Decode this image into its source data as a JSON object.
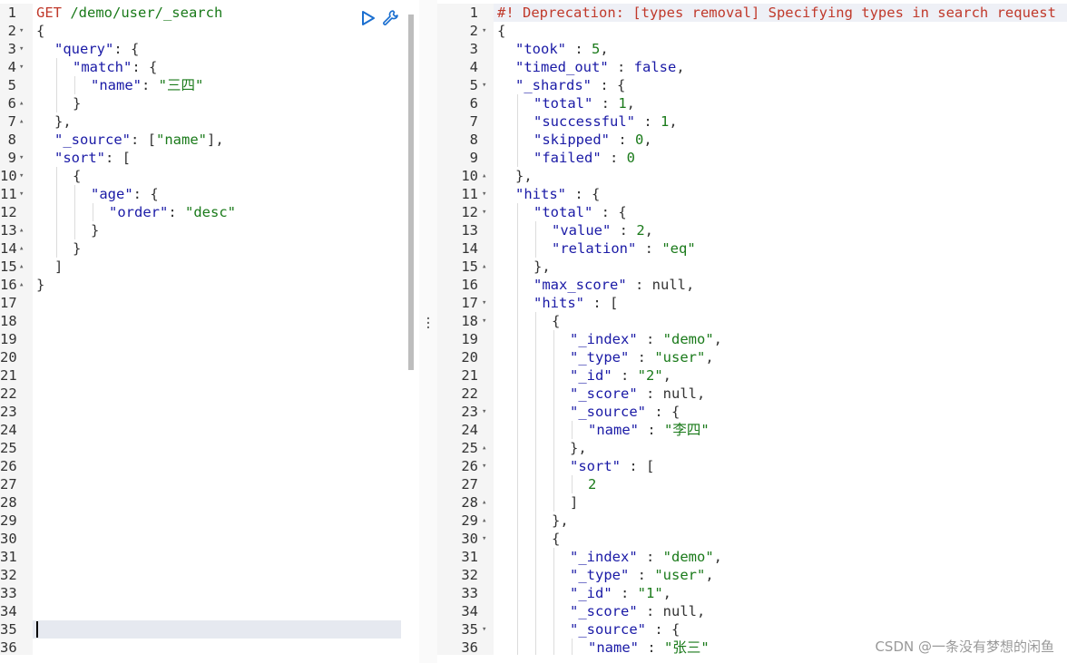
{
  "request": {
    "method": "GET",
    "path": "/demo/user/_search",
    "run_icon": "play-icon",
    "settings_icon": "wrench-icon"
  },
  "left_editor": {
    "line_count": 36,
    "active_line": 35,
    "lines": [
      {
        "n": 1,
        "fold": "",
        "indent": 0,
        "guides": 0,
        "tokens": [
          [
            "m",
            "GET "
          ],
          [
            "u",
            "/demo/user/_search"
          ]
        ]
      },
      {
        "n": 2,
        "fold": "down",
        "indent": 0,
        "guides": 0,
        "tokens": [
          [
            "p",
            "{"
          ]
        ]
      },
      {
        "n": 3,
        "fold": "down",
        "indent": 1,
        "guides": 0,
        "tokens": [
          [
            "k",
            "\"query\""
          ],
          [
            "p",
            ": {"
          ]
        ]
      },
      {
        "n": 4,
        "fold": "down",
        "indent": 1,
        "guides": 1,
        "tokens": [
          [
            "k",
            "\"match\""
          ],
          [
            "p",
            ": {"
          ]
        ]
      },
      {
        "n": 5,
        "fold": "",
        "indent": 1,
        "guides": 2,
        "tokens": [
          [
            "k",
            "\"name\""
          ],
          [
            "p",
            ": "
          ],
          [
            "s",
            "\"三四\""
          ]
        ]
      },
      {
        "n": 6,
        "fold": "up",
        "indent": 1,
        "guides": 1,
        "tokens": [
          [
            "p",
            "}"
          ]
        ]
      },
      {
        "n": 7,
        "fold": "up",
        "indent": 1,
        "guides": 0,
        "tokens": [
          [
            "p",
            "},"
          ]
        ]
      },
      {
        "n": 8,
        "fold": "",
        "indent": 1,
        "guides": 0,
        "tokens": [
          [
            "k",
            "\"_source\""
          ],
          [
            "p",
            ": ["
          ],
          [
            "s",
            "\"name\""
          ],
          [
            "p",
            "],"
          ]
        ]
      },
      {
        "n": 9,
        "fold": "down",
        "indent": 1,
        "guides": 0,
        "tokens": [
          [
            "k",
            "\"sort\""
          ],
          [
            "p",
            ": ["
          ]
        ]
      },
      {
        "n": 10,
        "fold": "down",
        "indent": 1,
        "guides": 1,
        "tokens": [
          [
            "p",
            "{"
          ]
        ]
      },
      {
        "n": 11,
        "fold": "down",
        "indent": 1,
        "guides": 2,
        "tokens": [
          [
            "k",
            "\"age\""
          ],
          [
            "p",
            ": {"
          ]
        ]
      },
      {
        "n": 12,
        "fold": "",
        "indent": 1,
        "guides": 3,
        "tokens": [
          [
            "k",
            "\"order\""
          ],
          [
            "p",
            ": "
          ],
          [
            "s",
            "\"desc\""
          ]
        ]
      },
      {
        "n": 13,
        "fold": "up",
        "indent": 1,
        "guides": 2,
        "tokens": [
          [
            "p",
            "}"
          ]
        ]
      },
      {
        "n": 14,
        "fold": "up",
        "indent": 1,
        "guides": 1,
        "tokens": [
          [
            "p",
            "}"
          ]
        ]
      },
      {
        "n": 15,
        "fold": "up",
        "indent": 1,
        "guides": 0,
        "tokens": [
          [
            "p",
            "]"
          ]
        ]
      },
      {
        "n": 16,
        "fold": "up",
        "indent": 0,
        "guides": 0,
        "tokens": [
          [
            "p",
            "}"
          ]
        ]
      },
      {
        "n": 17,
        "fold": "",
        "indent": 0,
        "guides": 0,
        "tokens": []
      },
      {
        "n": 18,
        "fold": "",
        "indent": 0,
        "guides": 0,
        "tokens": []
      },
      {
        "n": 19,
        "fold": "",
        "indent": 0,
        "guides": 0,
        "tokens": []
      },
      {
        "n": 20,
        "fold": "",
        "indent": 0,
        "guides": 0,
        "tokens": []
      },
      {
        "n": 21,
        "fold": "",
        "indent": 0,
        "guides": 0,
        "tokens": []
      },
      {
        "n": 22,
        "fold": "",
        "indent": 0,
        "guides": 0,
        "tokens": []
      },
      {
        "n": 23,
        "fold": "",
        "indent": 0,
        "guides": 0,
        "tokens": []
      },
      {
        "n": 24,
        "fold": "",
        "indent": 0,
        "guides": 0,
        "tokens": []
      },
      {
        "n": 25,
        "fold": "",
        "indent": 0,
        "guides": 0,
        "tokens": []
      },
      {
        "n": 26,
        "fold": "",
        "indent": 0,
        "guides": 0,
        "tokens": []
      },
      {
        "n": 27,
        "fold": "",
        "indent": 0,
        "guides": 0,
        "tokens": []
      },
      {
        "n": 28,
        "fold": "",
        "indent": 0,
        "guides": 0,
        "tokens": []
      },
      {
        "n": 29,
        "fold": "",
        "indent": 0,
        "guides": 0,
        "tokens": []
      },
      {
        "n": 30,
        "fold": "",
        "indent": 0,
        "guides": 0,
        "tokens": []
      },
      {
        "n": 31,
        "fold": "",
        "indent": 0,
        "guides": 0,
        "tokens": []
      },
      {
        "n": 32,
        "fold": "",
        "indent": 0,
        "guides": 0,
        "tokens": []
      },
      {
        "n": 33,
        "fold": "",
        "indent": 0,
        "guides": 0,
        "tokens": []
      },
      {
        "n": 34,
        "fold": "",
        "indent": 0,
        "guides": 0,
        "tokens": []
      },
      {
        "n": 35,
        "fold": "",
        "indent": 0,
        "guides": 0,
        "tokens": []
      },
      {
        "n": 36,
        "fold": "",
        "indent": 0,
        "guides": 0,
        "tokens": []
      }
    ]
  },
  "right_editor": {
    "lines": [
      {
        "n": 1,
        "fold": "",
        "indent": 0,
        "guides": 0,
        "tokens": [
          [
            "warn",
            "#! Deprecation: [types removal] Specifying types in search request"
          ]
        ]
      },
      {
        "n": 2,
        "fold": "down",
        "indent": 0,
        "guides": 0,
        "tokens": [
          [
            "p",
            "{"
          ]
        ]
      },
      {
        "n": 3,
        "fold": "",
        "indent": 1,
        "guides": 0,
        "tokens": [
          [
            "k",
            "\"took\""
          ],
          [
            "p",
            " : "
          ],
          [
            "n",
            "5"
          ],
          [
            "p",
            ","
          ]
        ]
      },
      {
        "n": 4,
        "fold": "",
        "indent": 1,
        "guides": 0,
        "tokens": [
          [
            "k",
            "\"timed_out\""
          ],
          [
            "p",
            " : "
          ],
          [
            "b",
            "false"
          ],
          [
            "p",
            ","
          ]
        ]
      },
      {
        "n": 5,
        "fold": "down",
        "indent": 1,
        "guides": 0,
        "tokens": [
          [
            "k",
            "\"_shards\""
          ],
          [
            "p",
            " : {"
          ]
        ]
      },
      {
        "n": 6,
        "fold": "",
        "indent": 1,
        "guides": 1,
        "tokens": [
          [
            "k",
            "\"total\""
          ],
          [
            "p",
            " : "
          ],
          [
            "n",
            "1"
          ],
          [
            "p",
            ","
          ]
        ]
      },
      {
        "n": 7,
        "fold": "",
        "indent": 1,
        "guides": 1,
        "tokens": [
          [
            "k",
            "\"successful\""
          ],
          [
            "p",
            " : "
          ],
          [
            "n",
            "1"
          ],
          [
            "p",
            ","
          ]
        ]
      },
      {
        "n": 8,
        "fold": "",
        "indent": 1,
        "guides": 1,
        "tokens": [
          [
            "k",
            "\"skipped\""
          ],
          [
            "p",
            " : "
          ],
          [
            "n",
            "0"
          ],
          [
            "p",
            ","
          ]
        ]
      },
      {
        "n": 9,
        "fold": "",
        "indent": 1,
        "guides": 1,
        "tokens": [
          [
            "k",
            "\"failed\""
          ],
          [
            "p",
            " : "
          ],
          [
            "n",
            "0"
          ]
        ]
      },
      {
        "n": 10,
        "fold": "up",
        "indent": 1,
        "guides": 0,
        "tokens": [
          [
            "p",
            "},"
          ]
        ]
      },
      {
        "n": 11,
        "fold": "down",
        "indent": 1,
        "guides": 0,
        "tokens": [
          [
            "k",
            "\"hits\""
          ],
          [
            "p",
            " : {"
          ]
        ]
      },
      {
        "n": 12,
        "fold": "down",
        "indent": 1,
        "guides": 1,
        "tokens": [
          [
            "k",
            "\"total\""
          ],
          [
            "p",
            " : {"
          ]
        ]
      },
      {
        "n": 13,
        "fold": "",
        "indent": 1,
        "guides": 2,
        "tokens": [
          [
            "k",
            "\"value\""
          ],
          [
            "p",
            " : "
          ],
          [
            "n",
            "2"
          ],
          [
            "p",
            ","
          ]
        ]
      },
      {
        "n": 14,
        "fold": "",
        "indent": 1,
        "guides": 2,
        "tokens": [
          [
            "k",
            "\"relation\""
          ],
          [
            "p",
            " : "
          ],
          [
            "s",
            "\"eq\""
          ]
        ]
      },
      {
        "n": 15,
        "fold": "up",
        "indent": 1,
        "guides": 1,
        "tokens": [
          [
            "p",
            "},"
          ]
        ]
      },
      {
        "n": 16,
        "fold": "",
        "indent": 1,
        "guides": 1,
        "tokens": [
          [
            "k",
            "\"max_score\""
          ],
          [
            "p",
            " : "
          ],
          [
            "nul",
            "null"
          ],
          [
            "p",
            ","
          ]
        ]
      },
      {
        "n": 17,
        "fold": "down",
        "indent": 1,
        "guides": 1,
        "tokens": [
          [
            "k",
            "\"hits\""
          ],
          [
            "p",
            " : ["
          ]
        ]
      },
      {
        "n": 18,
        "fold": "down",
        "indent": 1,
        "guides": 2,
        "tokens": [
          [
            "p",
            "{"
          ]
        ]
      },
      {
        "n": 19,
        "fold": "",
        "indent": 1,
        "guides": 3,
        "tokens": [
          [
            "k",
            "\"_index\""
          ],
          [
            "p",
            " : "
          ],
          [
            "s",
            "\"demo\""
          ],
          [
            "p",
            ","
          ]
        ]
      },
      {
        "n": 20,
        "fold": "",
        "indent": 1,
        "guides": 3,
        "tokens": [
          [
            "k",
            "\"_type\""
          ],
          [
            "p",
            " : "
          ],
          [
            "s",
            "\"user\""
          ],
          [
            "p",
            ","
          ]
        ]
      },
      {
        "n": 21,
        "fold": "",
        "indent": 1,
        "guides": 3,
        "tokens": [
          [
            "k",
            "\"_id\""
          ],
          [
            "p",
            " : "
          ],
          [
            "s",
            "\"2\""
          ],
          [
            "p",
            ","
          ]
        ]
      },
      {
        "n": 22,
        "fold": "",
        "indent": 1,
        "guides": 3,
        "tokens": [
          [
            "k",
            "\"_score\""
          ],
          [
            "p",
            " : "
          ],
          [
            "nul",
            "null"
          ],
          [
            "p",
            ","
          ]
        ]
      },
      {
        "n": 23,
        "fold": "down",
        "indent": 1,
        "guides": 3,
        "tokens": [
          [
            "k",
            "\"_source\""
          ],
          [
            "p",
            " : {"
          ]
        ]
      },
      {
        "n": 24,
        "fold": "",
        "indent": 1,
        "guides": 4,
        "tokens": [
          [
            "k",
            "\"name\""
          ],
          [
            "p",
            " : "
          ],
          [
            "s",
            "\"李四\""
          ]
        ]
      },
      {
        "n": 25,
        "fold": "up",
        "indent": 1,
        "guides": 3,
        "tokens": [
          [
            "p",
            "},"
          ]
        ]
      },
      {
        "n": 26,
        "fold": "down",
        "indent": 1,
        "guides": 3,
        "tokens": [
          [
            "k",
            "\"sort\""
          ],
          [
            "p",
            " : ["
          ]
        ]
      },
      {
        "n": 27,
        "fold": "",
        "indent": 1,
        "guides": 4,
        "tokens": [
          [
            "n",
            "2"
          ]
        ]
      },
      {
        "n": 28,
        "fold": "up",
        "indent": 1,
        "guides": 3,
        "tokens": [
          [
            "p",
            "]"
          ]
        ]
      },
      {
        "n": 29,
        "fold": "up",
        "indent": 1,
        "guides": 2,
        "tokens": [
          [
            "p",
            "},"
          ]
        ]
      },
      {
        "n": 30,
        "fold": "down",
        "indent": 1,
        "guides": 2,
        "tokens": [
          [
            "p",
            "{"
          ]
        ]
      },
      {
        "n": 31,
        "fold": "",
        "indent": 1,
        "guides": 3,
        "tokens": [
          [
            "k",
            "\"_index\""
          ],
          [
            "p",
            " : "
          ],
          [
            "s",
            "\"demo\""
          ],
          [
            "p",
            ","
          ]
        ]
      },
      {
        "n": 32,
        "fold": "",
        "indent": 1,
        "guides": 3,
        "tokens": [
          [
            "k",
            "\"_type\""
          ],
          [
            "p",
            " : "
          ],
          [
            "s",
            "\"user\""
          ],
          [
            "p",
            ","
          ]
        ]
      },
      {
        "n": 33,
        "fold": "",
        "indent": 1,
        "guides": 3,
        "tokens": [
          [
            "k",
            "\"_id\""
          ],
          [
            "p",
            " : "
          ],
          [
            "s",
            "\"1\""
          ],
          [
            "p",
            ","
          ]
        ]
      },
      {
        "n": 34,
        "fold": "",
        "indent": 1,
        "guides": 3,
        "tokens": [
          [
            "k",
            "\"_score\""
          ],
          [
            "p",
            " : "
          ],
          [
            "nul",
            "null"
          ],
          [
            "p",
            ","
          ]
        ]
      },
      {
        "n": 35,
        "fold": "down",
        "indent": 1,
        "guides": 3,
        "tokens": [
          [
            "k",
            "\"_source\""
          ],
          [
            "p",
            " : {"
          ]
        ]
      },
      {
        "n": 36,
        "fold": "",
        "indent": 1,
        "guides": 4,
        "tokens": [
          [
            "k",
            "\"name\""
          ],
          [
            "p",
            " : "
          ],
          [
            "s",
            "\"张三\""
          ]
        ]
      }
    ]
  },
  "watermark": "CSDN @一条没有梦想的闲鱼",
  "colors": {
    "key": "#1a1aa6",
    "string": "#1a7a1a",
    "method": "#c0392b",
    "warning": "#c0392b",
    "gutter": "#f5f5f5",
    "active_line": "#e6e9f0"
  }
}
